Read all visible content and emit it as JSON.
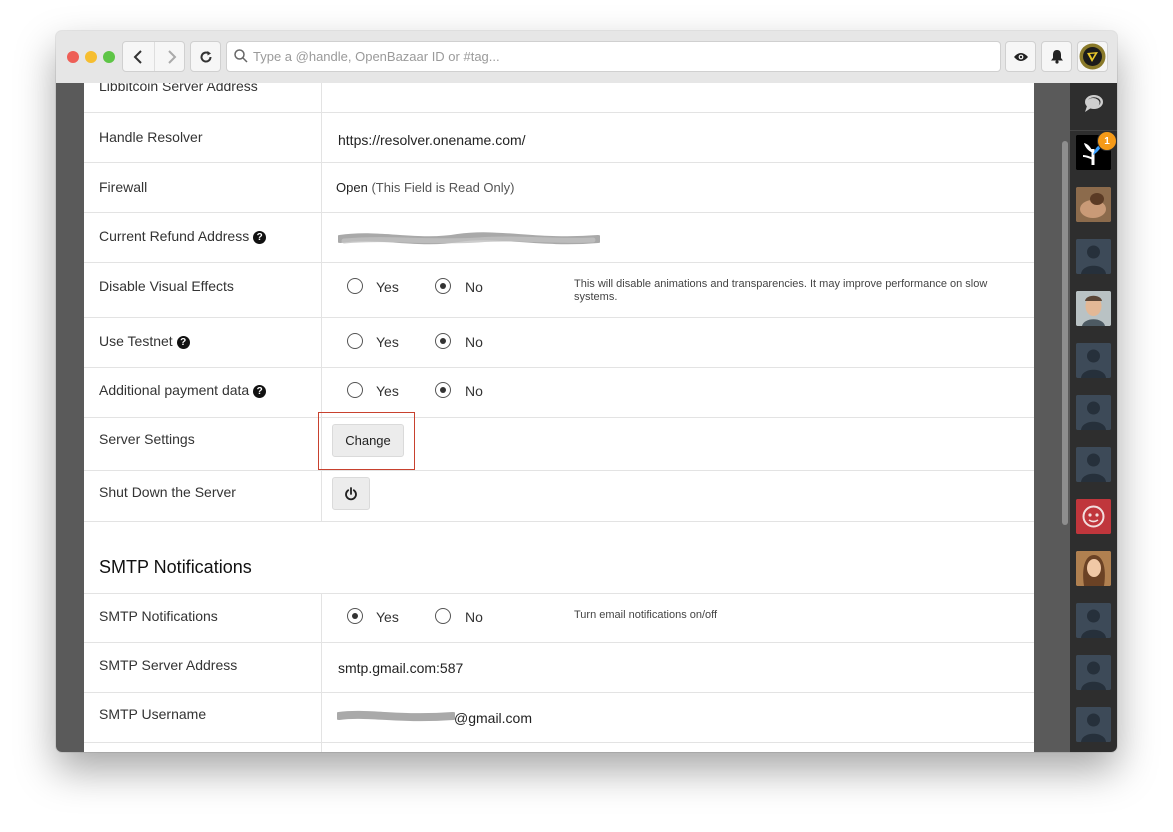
{
  "toolbar": {
    "search_placeholder": "Type a @handle, OpenBazaar ID or #tag..."
  },
  "settings": {
    "libbitcoin_label": "Libbitcoin Server Address",
    "handle_resolver": {
      "label": "Handle Resolver",
      "value": "https://resolver.onename.com/"
    },
    "firewall": {
      "label": "Firewall",
      "value": "Open",
      "note": "(This Field is Read Only)"
    },
    "refund_address": {
      "label": "Current Refund Address",
      "help": "?"
    },
    "visual_effects": {
      "label": "Disable Visual Effects",
      "yes": "Yes",
      "no": "No",
      "selected": "No",
      "hint": "This will disable animations and transparencies. It may improve performance on slow systems."
    },
    "testnet": {
      "label": "Use Testnet",
      "help": "?",
      "yes": "Yes",
      "no": "No",
      "selected": "No"
    },
    "payment_data": {
      "label": "Additional payment data",
      "help": "?",
      "yes": "Yes",
      "no": "No",
      "selected": "No"
    },
    "server_settings": {
      "label": "Server Settings",
      "button": "Change"
    },
    "shutdown": {
      "label": "Shut Down the Server"
    }
  },
  "smtp": {
    "section_title": "SMTP Notifications",
    "notifications": {
      "label": "SMTP Notifications",
      "yes": "Yes",
      "no": "No",
      "selected": "Yes",
      "hint": "Turn email notifications on/off"
    },
    "server_address": {
      "label": "SMTP Server Address",
      "value": "smtp.gmail.com:587"
    },
    "username": {
      "label": "SMTP Username",
      "value_suffix": "@gmail.com"
    }
  },
  "sidebar": {
    "notification_count": "1"
  },
  "colors": {
    "highlight": "#c8412e",
    "badge": "#f59a18",
    "rightbar_bg": "#2e2e2e"
  }
}
